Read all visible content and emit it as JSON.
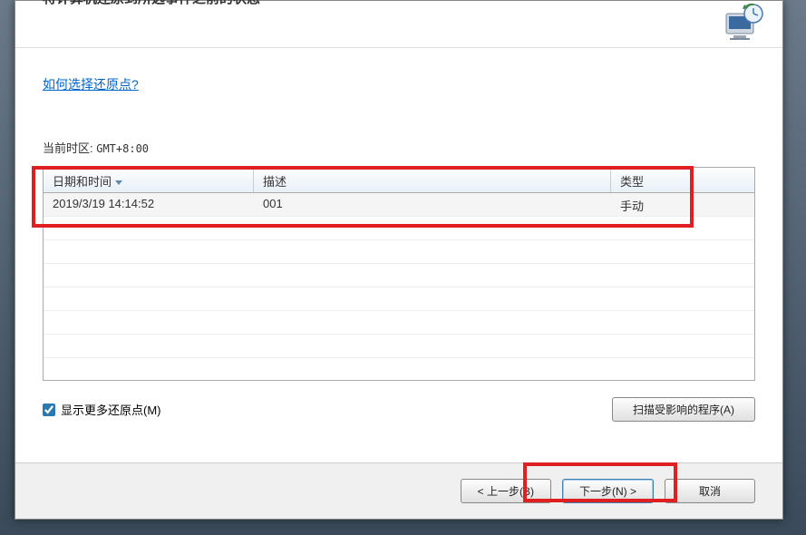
{
  "header": {
    "title_fragment": "将计算机还原到所选事件之前的状态",
    "icon_name": "system-restore-icon"
  },
  "content": {
    "help_link": "如何选择还原点?",
    "timezone_label": "当前时区: ",
    "timezone_value": "GMT+8:00"
  },
  "table": {
    "headers": {
      "date": "日期和时间",
      "desc": "描述",
      "type": "类型"
    },
    "rows": [
      {
        "date": "2019/3/19 14:14:52",
        "desc": "001",
        "type": "手动"
      }
    ]
  },
  "controls": {
    "show_more_label": "显示更多还原点(M)",
    "show_more_checked": true,
    "scan_button": "扫描受影响的程序(A)"
  },
  "footer": {
    "back": "< 上一步(B)",
    "next": "下一步(N) >",
    "cancel": "取消"
  }
}
